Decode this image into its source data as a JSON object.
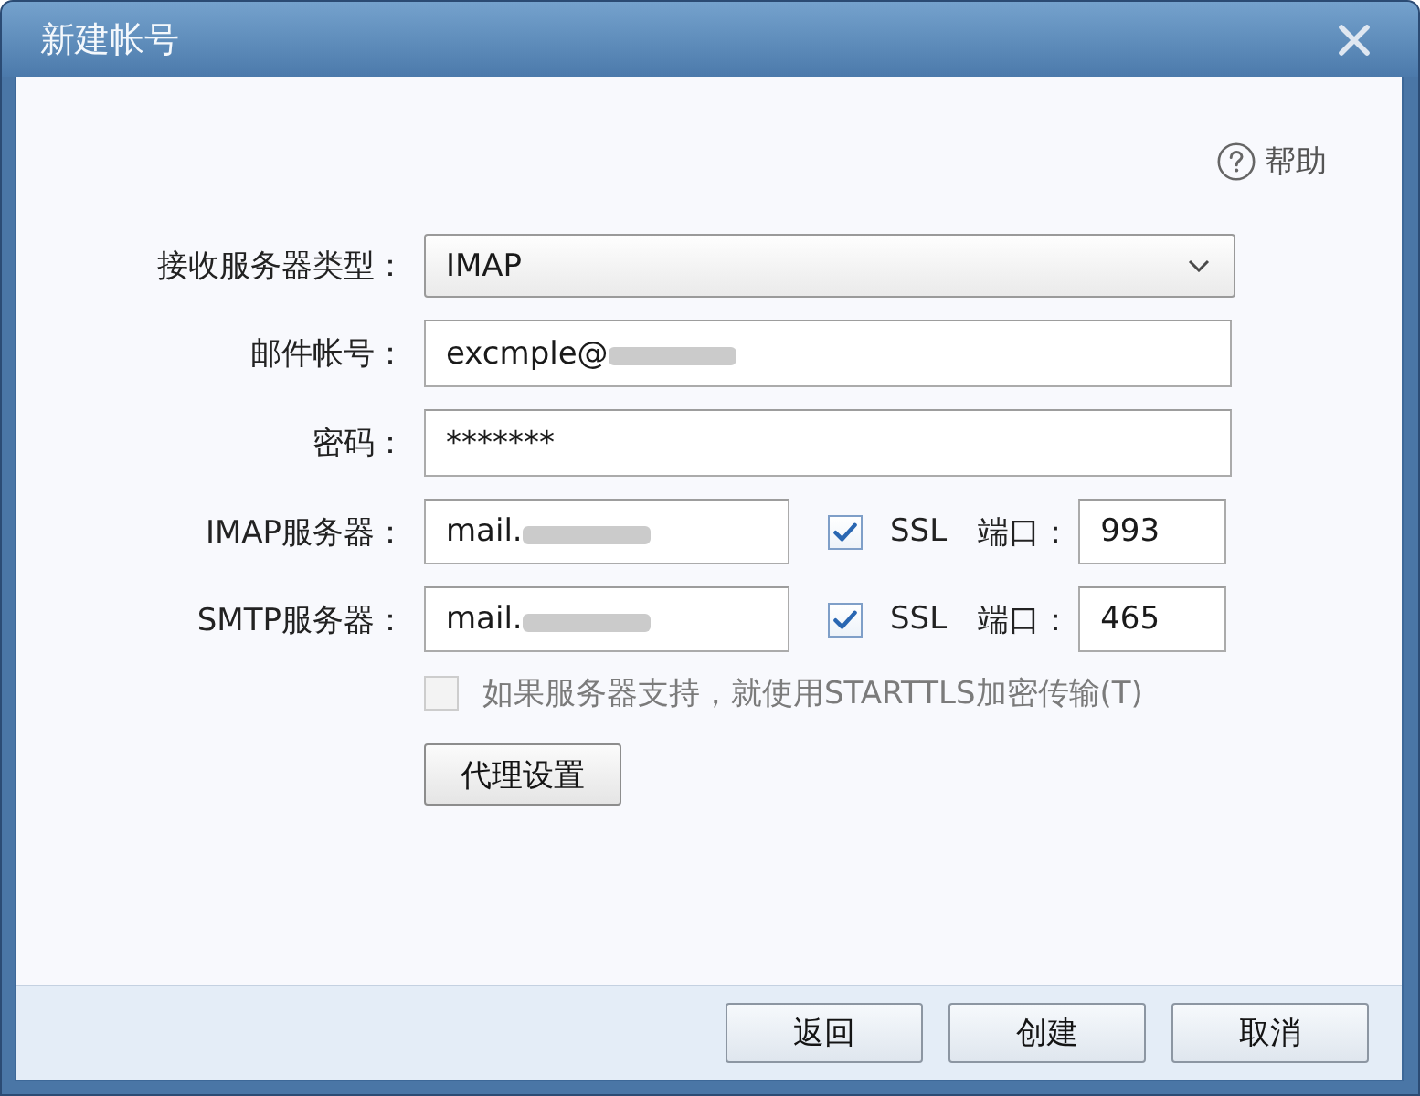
{
  "window": {
    "title": "新建帐号"
  },
  "help": {
    "label": "帮助"
  },
  "form": {
    "receive_server_type": {
      "label": "接收服务器类型：",
      "value": "IMAP"
    },
    "email_account": {
      "label": "邮件帐号：",
      "value": "excmple@",
      "obscured": true
    },
    "password": {
      "label": "密码：",
      "value": "*******"
    },
    "servers": [
      {
        "label": "IMAP服务器：",
        "value": "mail.",
        "obscured": true,
        "ssl": {
          "label": "SSL",
          "checked": true
        },
        "port_label": "端口：",
        "port": "993"
      },
      {
        "label": "SMTP服务器：",
        "value": "mail.",
        "obscured": true,
        "ssl": {
          "label": "SSL",
          "checked": true
        },
        "port_label": "端口：",
        "port": "465"
      }
    ],
    "starttls": {
      "label": "如果服务器支持，就使用STARTTLS加密传输(T)",
      "checked": false,
      "disabled": true
    },
    "proxy_button": {
      "label": "代理设置"
    }
  },
  "buttons": [
    {
      "label": "返回"
    },
    {
      "label": "创建"
    },
    {
      "label": "取消"
    }
  ]
}
